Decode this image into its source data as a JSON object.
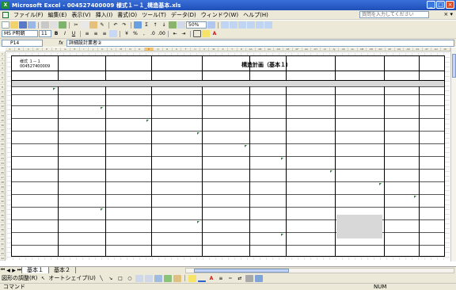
{
  "window": {
    "title": "Microsoft Excel - 004527400009 様式１－１_構造基本.xls",
    "app_icon": "excel-icon"
  },
  "menu": {
    "items": [
      "ファイル(F)",
      "編集(E)",
      "表示(V)",
      "挿入(I)",
      "書式(O)",
      "ツール(T)",
      "データ(D)",
      "ウィンドウ(W)",
      "ヘルプ(H)"
    ],
    "help_placeholder": "質問を入力してください"
  },
  "toolbar": {
    "zoom": "50%",
    "font_name": "MS P明朝",
    "font_size": "11"
  },
  "formula_bar": {
    "cell_ref": "P14",
    "fx": "fx",
    "value": "詳細設計業者②"
  },
  "sheet_form": {
    "title": "構造計画（基本１）",
    "top_left_line1": "様式 １－１",
    "top_left_line2": "004527400009"
  },
  "sheet_tabs": [
    "基本１",
    "基本２"
  ],
  "active_tab": "基本１",
  "drawing_toolbar": {
    "draw_label": "図形の調整(R)",
    "autoshape_label": "オートシェイプ(U)"
  },
  "status": {
    "left": "コマンド",
    "num": "NUM"
  }
}
